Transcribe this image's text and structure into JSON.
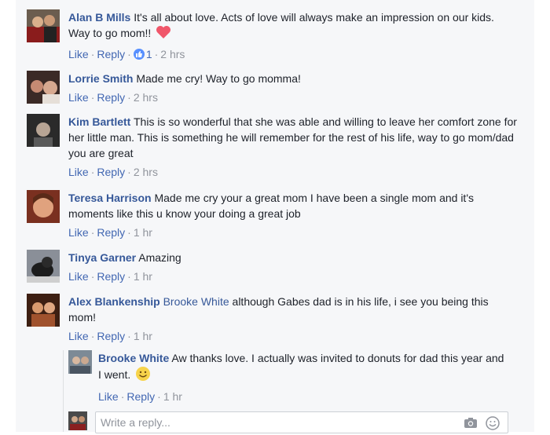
{
  "actions": {
    "like": "Like",
    "reply": "Reply",
    "separator": "·"
  },
  "comments": [
    {
      "author": "Alan B Mills",
      "mention": "",
      "text": "It's all about love. Acts of love will always make an impression on our kids. Way to go mom!!",
      "time": "2 hrs",
      "like_count": "1",
      "emoji": "heart-icon"
    },
    {
      "author": "Lorrie Smith",
      "mention": "",
      "text": "Made me cry! Way to go momma!",
      "time": "2 hrs"
    },
    {
      "author": "Kim Bartlett",
      "mention": "",
      "text": "This is so wonderful that she was able and willing to leave her comfort zone for her little man. This is something he will remember for the rest of his life, way to go mom/dad you are great",
      "time": "2 hrs"
    },
    {
      "author": "Teresa Harrison",
      "mention": "",
      "text": "Made me cry your a great mom I have been a single mom and it's moments like this u know your doing a great job",
      "time": "1 hr"
    },
    {
      "author": "Tinya Garner",
      "mention": "",
      "text": "Amazing",
      "time": "1 hr"
    },
    {
      "author": "Alex Blankenship",
      "mention": "Brooke White",
      "text": "although Gabes dad is in his life, i see you being this mom!",
      "time": "1 hr"
    },
    {
      "author": "Brooke White",
      "mention": "",
      "text": "Aw thanks love. I actually was invited to donuts for dad this year and I went.",
      "time": "1 hr",
      "emoji": "smile-icon"
    }
  ],
  "reply_box": {
    "placeholder": "Write a reply..."
  },
  "colors": {
    "name": "#365899",
    "link": "#4267b2",
    "meta": "#90949c",
    "panel": "#f6f7f9"
  }
}
